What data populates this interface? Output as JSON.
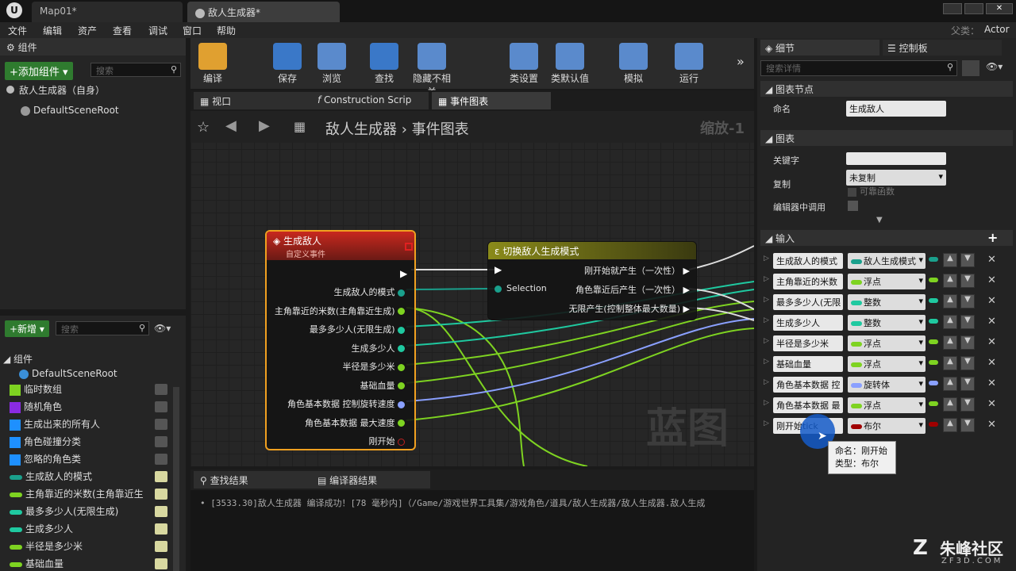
{
  "tabs": [
    "Map01*",
    "敌人生成器*"
  ],
  "titlebar": {
    "parent_label": "父类：",
    "parent_value": "Actor"
  },
  "menu": [
    "文件",
    "编辑",
    "资产",
    "查看",
    "调试",
    "窗口",
    "帮助"
  ],
  "components": {
    "title": "组件",
    "add_button": "+添加组件 ▾",
    "search_placeholder": "搜索",
    "self_item": "敌人生成器（自身）",
    "root": "DefaultSceneRoot"
  },
  "toolbar": [
    "编译",
    "保存",
    "浏览",
    "查找",
    "隐藏不相关",
    "类设置",
    "类默认值",
    "模拟",
    "运行"
  ],
  "editor_tabs": [
    "视口",
    "Construction Scrip",
    "事件图表"
  ],
  "breadcrumb": {
    "bp": "敌人生成器",
    "graph": "事件图表",
    "zoom": "缩放-1"
  },
  "watermark": "蓝图",
  "node_event": {
    "title": "生成敌人",
    "subtitle": "自定义事件",
    "pins": [
      "生成敌人的模式",
      "主角靠近的米数(主角靠近生成)",
      "最多多少人(无限生成)",
      "生成多少人",
      "半径是多少米",
      "基础血量",
      "角色基本数据 控制旋转速度",
      "角色基本数据 最大速度",
      "刚开始"
    ]
  },
  "node_switch": {
    "title": "切换敌人生成模式",
    "in_pin": "Selection",
    "pins": [
      "刚开始就产生（一次性）",
      "角色靠近后产生（一次性）",
      "无限产生(控制整体最大数量)"
    ]
  },
  "bottom_tabs": [
    "查找结果",
    "编译器结果"
  ],
  "log": "[3533.30]敌人生成器 编译成功！[78 毫秒内]（/Game/游戏世界工具集/游戏角色/道具/敌人生成器/敌人生成器.敌人生成",
  "mybp": {
    "new_button": "+新增 ▾",
    "search_placeholder": "搜索",
    "group_components": "组件",
    "root": "DefaultSceneRoot",
    "vars": [
      {
        "name": "临时数组",
        "color": "#7ed321"
      },
      {
        "name": "随机角色",
        "color": "#8a2be2"
      },
      {
        "name": "生成出来的所有人",
        "color": "#1e90ff"
      },
      {
        "name": "角色碰撞分类",
        "color": "#1e90ff"
      },
      {
        "name": "忽略的角色类",
        "color": "#1e90ff"
      },
      {
        "name": "生成敌人的模式",
        "color": "#1aa08c"
      },
      {
        "name": "主角靠近的米数(主角靠近生",
        "color": "#7ed321"
      },
      {
        "name": "最多多少人(无限生成)",
        "color": "#1fc9a0"
      },
      {
        "name": "生成多少人",
        "color": "#1fc9a0"
      },
      {
        "name": "半径是多少米",
        "color": "#7ed321"
      },
      {
        "name": "基础血量",
        "color": "#7ed321"
      }
    ]
  },
  "details": {
    "tab1": "细节",
    "tab2": "控制板",
    "search_placeholder": "搜索详情",
    "sec_node": "图表节点",
    "name_label": "命名",
    "name_value": "生成敌人",
    "sec_graph": "图表",
    "keyword_label": "关键字",
    "replicate_label": "复制",
    "replicate_value": "未复制",
    "reliable": "可靠函数",
    "editor_call": "编辑器中调用",
    "sec_inputs": "输入",
    "inputs": [
      {
        "name": "生成敌人的模式",
        "type": "敌人生成模式",
        "color": "#1aa08c"
      },
      {
        "name": "主角靠近的米数",
        "type": "浮点",
        "color": "#7ed321"
      },
      {
        "name": "最多多少人(无限",
        "type": "整数",
        "color": "#1fc9a0"
      },
      {
        "name": "生成多少人",
        "type": "整数",
        "color": "#1fc9a0"
      },
      {
        "name": "半径是多少米",
        "type": "浮点",
        "color": "#7ed321"
      },
      {
        "name": "基础血量",
        "type": "浮点",
        "color": "#7ed321"
      },
      {
        "name": "角色基本数据 控",
        "type": "旋转体",
        "color": "#8aa0ff"
      },
      {
        "name": "角色基本数据 最",
        "type": "浮点",
        "color": "#7ed321"
      },
      {
        "name": "刚开始tick",
        "type": "布尔",
        "color": "#a00000"
      }
    ],
    "tooltip_l1": "命名：刚开始",
    "tooltip_l2": "类型：布尔"
  },
  "brand": {
    "name": "朱峰社区",
    "url": "ZF3D.COM"
  }
}
